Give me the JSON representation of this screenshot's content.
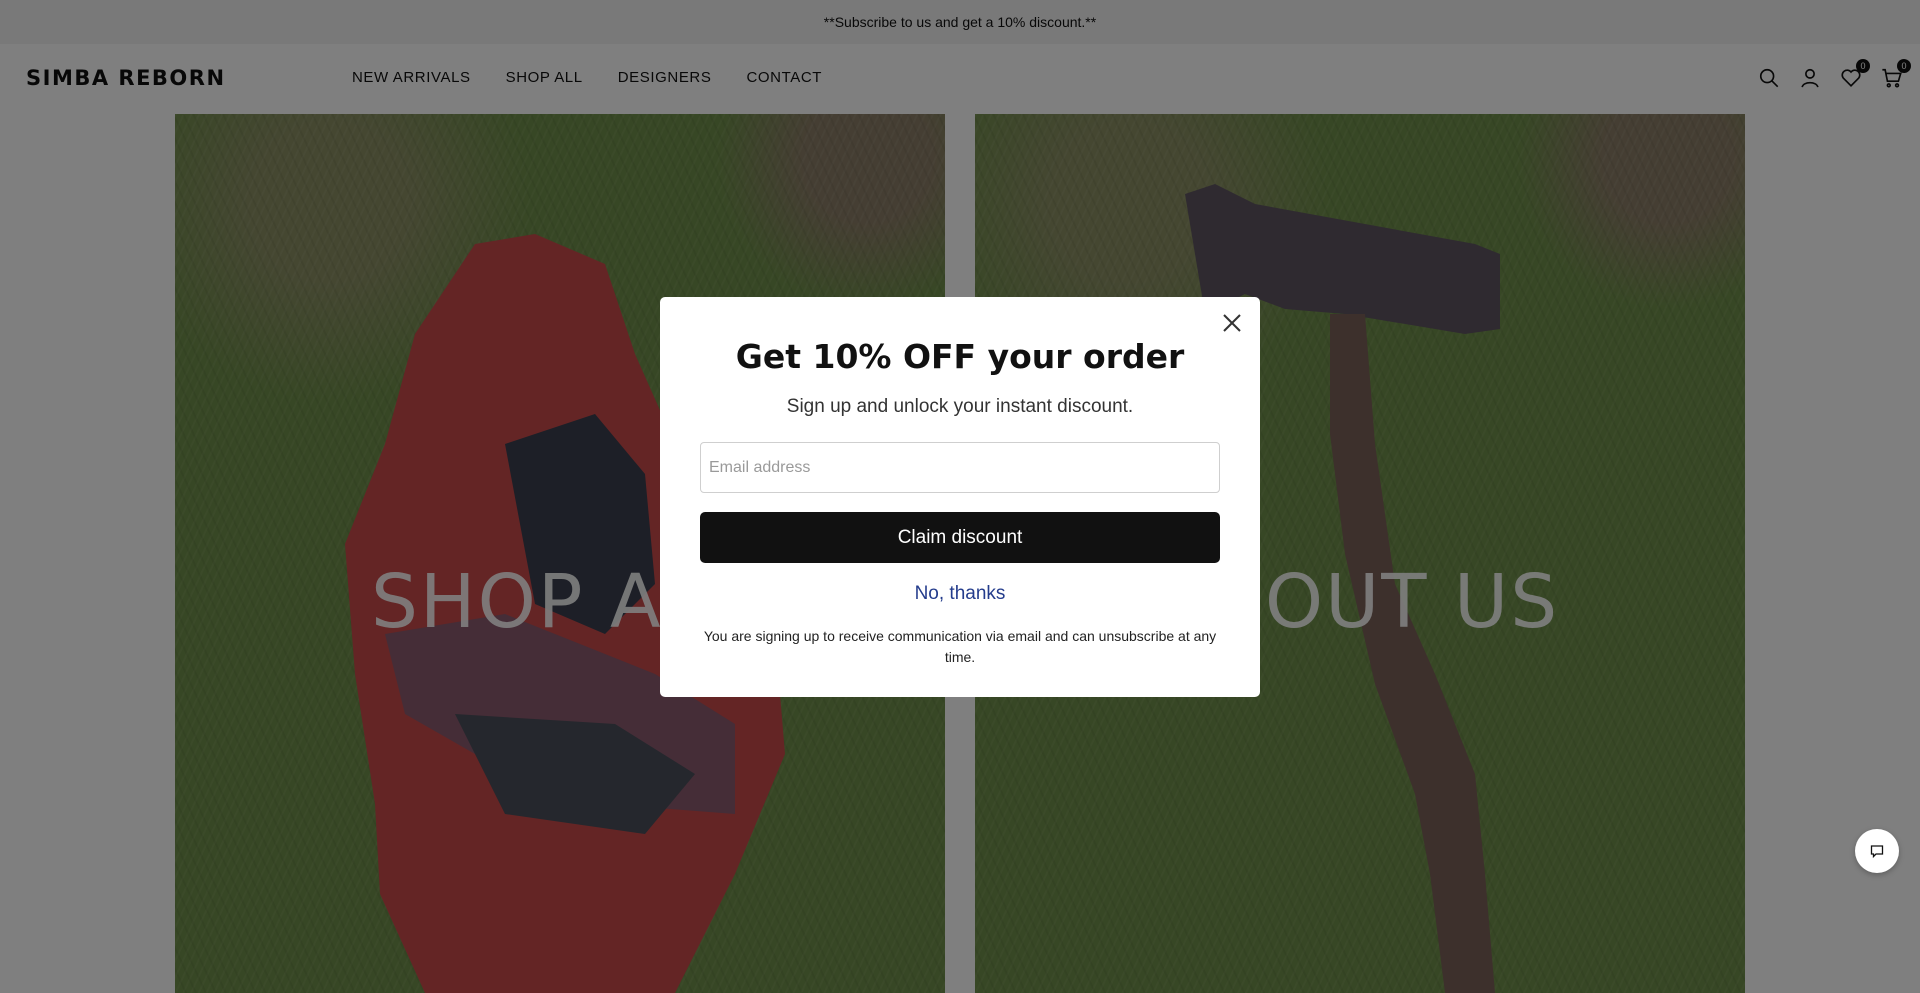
{
  "announcement": {
    "text": "**Subscribe to us and get a 10% discount.**"
  },
  "header": {
    "logo": "SIMBA REBORN",
    "nav": [
      {
        "label": "NEW ARRIVALS"
      },
      {
        "label": "SHOP ALL"
      },
      {
        "label": "DESIGNERS"
      },
      {
        "label": "CONTACT"
      }
    ],
    "icons": [
      "search-icon",
      "account-icon",
      "wishlist-icon",
      "cart-icon"
    ],
    "wishlist_count": "0",
    "cart_count": "0"
  },
  "hero": {
    "left_title": "SHOP ALL",
    "right_title": "ABOUT US"
  },
  "modal": {
    "title": "Get 10% OFF your order",
    "subtitle": "Sign up and unlock your instant discount.",
    "email_placeholder": "Email address",
    "email_value": "",
    "claim_label": "Claim discount",
    "decline_label": "No, thanks",
    "disclaimer": "You are signing up to receive communication via email and can unsubscribe at any time."
  },
  "colors": {
    "overlay": "#000000",
    "button": "#111111",
    "link": "#243c8c",
    "grass": "#6f8f4a"
  }
}
